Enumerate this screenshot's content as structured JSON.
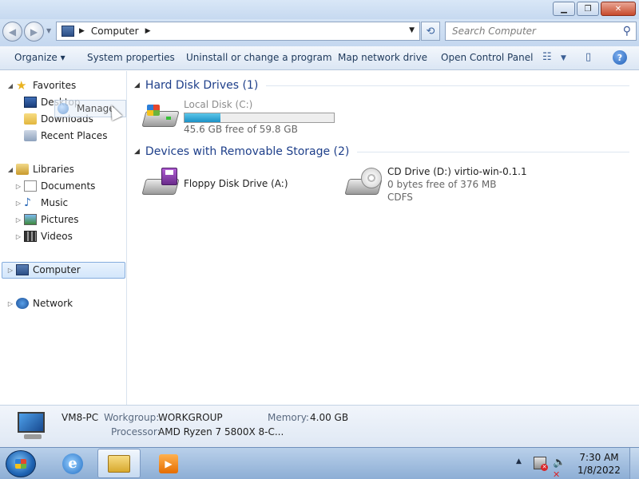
{
  "window": {
    "controls": {
      "minimize": "▁",
      "restore": "❐",
      "close": "✕"
    }
  },
  "address_bar": {
    "location": "Computer",
    "search_placeholder": "Search Computer"
  },
  "toolbar": {
    "organize": "Organize ▾",
    "system_properties": "System properties",
    "uninstall": "Uninstall or change a program",
    "map_network_drive": "Map network drive",
    "open_control_panel": "Open Control Panel",
    "help": "?"
  },
  "nav": {
    "favorites": "Favorites",
    "desktop": "Desktop",
    "downloads": "Downloads",
    "recent_places": "Recent Places",
    "libraries": "Libraries",
    "documents": "Documents",
    "music": "Music",
    "pictures": "Pictures",
    "videos": "Videos",
    "computer": "Computer",
    "network": "Network"
  },
  "drag_ghost": {
    "label": "Manage"
  },
  "content": {
    "hard_disk_group": "Hard Disk Drives (1)",
    "removable_group": "Devices with Removable Storage (2)",
    "local_disk": {
      "name": "Local Disk (C:)",
      "free": "45.6 GB free of 59.8 GB",
      "used_fraction": 0.24
    },
    "floppy": {
      "name": "Floppy Disk Drive (A:)"
    },
    "cd_drive": {
      "name": "CD Drive (D:) virtio-win-0.1.1",
      "free": "0 bytes free of 376 MB",
      "fs": "CDFS"
    }
  },
  "details": {
    "pc_name": "VM8-PC",
    "workgroup_label": "Workgroup:",
    "workgroup": "WORKGROUP",
    "memory_label": "Memory:",
    "memory": "4.00 GB",
    "processor_label": "Processor:",
    "processor": "AMD Ryzen 7 5800X 8-C..."
  },
  "taskbar": {
    "time": "7:30 AM",
    "date": "1/8/2022",
    "ie_glyph": "e",
    "wmp_glyph": "▶"
  },
  "icons": {
    "favorites": "star-icon",
    "desktop": "desktop-icon",
    "downloads": "downloads-folder-icon",
    "recent_places": "recent-places-icon",
    "libraries": "libraries-icon",
    "documents": "documents-icon",
    "music": "music-icon",
    "pictures": "pictures-icon",
    "videos": "videos-icon",
    "computer": "computer-icon",
    "network": "network-icon"
  },
  "colors": {
    "accent": "#1e3f8a",
    "disk_bar": "#1c92c6",
    "selection": "#d3e6fb"
  }
}
